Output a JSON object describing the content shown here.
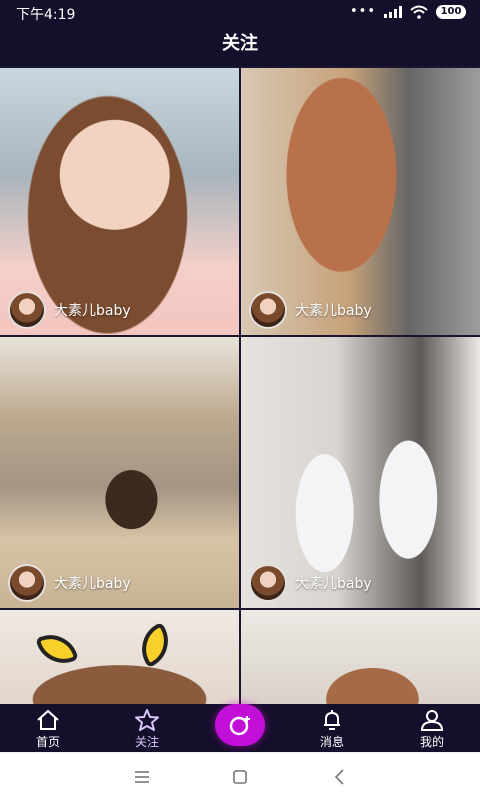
{
  "status_bar": {
    "time": "下午4:19",
    "battery": "100"
  },
  "header": {
    "title": "关注"
  },
  "feed": {
    "tiles": [
      {
        "author": "大素儿baby",
        "show_author": true
      },
      {
        "author": "大素儿baby",
        "show_author": true
      },
      {
        "author": "大素儿baby",
        "show_author": true
      },
      {
        "author": "大素儿baby",
        "show_author": true
      },
      {
        "author": "",
        "show_author": false
      },
      {
        "author": "",
        "show_author": false
      }
    ]
  },
  "bottom_nav": {
    "items": [
      {
        "label": "首页",
        "icon": "home-icon"
      },
      {
        "label": "关注",
        "icon": "star-icon",
        "active": true
      },
      {
        "label": "",
        "icon": "camera-icon"
      },
      {
        "label": "消息",
        "icon": "bell-icon"
      },
      {
        "label": "我的",
        "icon": "person-icon"
      }
    ]
  },
  "colors": {
    "bar_background": "#140f2a",
    "accent": "#c10fd8",
    "active_tab": "#d9c6ff"
  }
}
